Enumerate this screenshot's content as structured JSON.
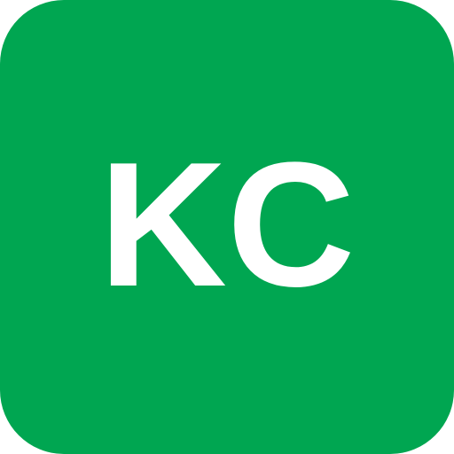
{
  "avatar": {
    "initials": "KC",
    "background_color": "#00A651",
    "text_color": "#FFFFFF"
  }
}
